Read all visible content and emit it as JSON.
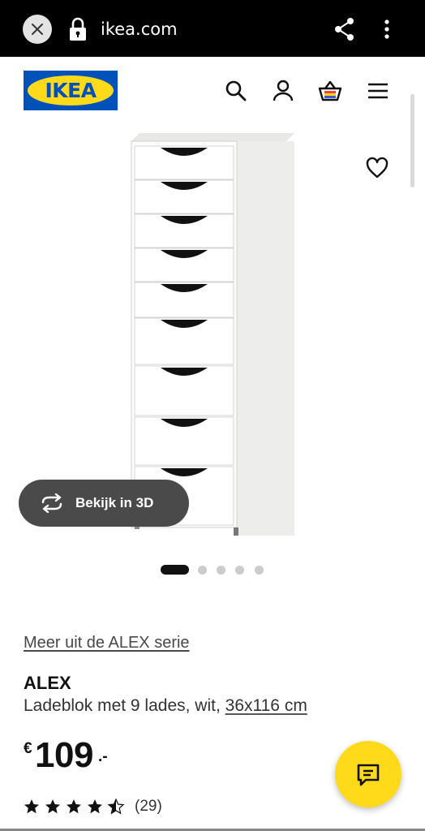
{
  "browser": {
    "url": "ikea.com"
  },
  "header": {
    "logo_text": "IKEA"
  },
  "gallery": {
    "view_3d_label": "Bekijk in 3D",
    "image_count": 5,
    "active_index": 0
  },
  "product": {
    "series_link": "Meer uit de ALEX serie",
    "name": "ALEX",
    "description": "Ladeblok met 9 lades, wit, ",
    "size_link": "36x116 cm",
    "currency": "€",
    "price_integer": "109",
    "price_decimal": ".-",
    "rating": 4.5,
    "rating_max": 5,
    "review_count": "(29)"
  },
  "colors": {
    "ikea_blue": "#0051ba",
    "ikea_yellow": "#ffda1a",
    "pill": "#4a4a4a"
  },
  "icons": [
    "close-icon",
    "lock-icon",
    "share-icon",
    "more-vertical-icon",
    "search-icon",
    "user-icon",
    "basket-icon",
    "menu-icon",
    "heart-icon",
    "rotate-3d-icon",
    "star-icon",
    "chat-icon"
  ]
}
